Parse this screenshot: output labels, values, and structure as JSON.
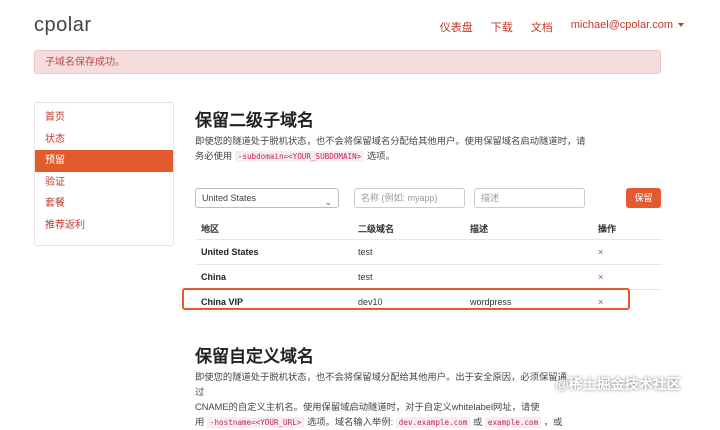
{
  "header": {
    "brand": "cpolar",
    "nav": [
      {
        "label": "仪表盘"
      },
      {
        "label": "下载"
      },
      {
        "label": "文档"
      },
      {
        "label": "michael@cpolar.com"
      }
    ]
  },
  "alert": {
    "text": "子域名保存成功。"
  },
  "sidebar": {
    "items": [
      {
        "label": "首页"
      },
      {
        "label": "状态"
      },
      {
        "label": "预留"
      },
      {
        "label": "验证"
      },
      {
        "label": "套餐"
      },
      {
        "label": "推荐返利"
      }
    ],
    "active_index": 2
  },
  "subdomain": {
    "title": "保留二级子域名",
    "desc_part1": "即使您的隧道处于脱机状态，也不会将保留域名分配给其他用户。使用保留域名启动隧道时，请务必使用",
    "desc_code": "-subdomain=<YOUR_SUBDOMAIN>",
    "desc_part2": "选项。",
    "form": {
      "region_selected": "United States",
      "name_placeholder": "名称 (例如: myapp)",
      "desc_placeholder": "描述",
      "save_label": "保留"
    },
    "table": {
      "headers": [
        "地区",
        "二级域名",
        "描述",
        "操作"
      ],
      "rows": [
        {
          "region": "United States",
          "subdomain": "test",
          "description": "",
          "action": "×"
        },
        {
          "region": "China",
          "subdomain": "test",
          "description": "",
          "action": "×"
        },
        {
          "region": "China VIP",
          "subdomain": "dev10",
          "description": "wordpress",
          "action": "×"
        }
      ]
    }
  },
  "custom": {
    "title": "保留自定义域名",
    "desc_line1": "即使您的隧道处于脱机状态，也不会将保留域分配给其他用户。出于安全原因，必须保留通过",
    "desc_line2": "CNAME的自定义主机名。使用保留域启动隧道时，对于自定义whitelabel网址，请使",
    "desc_line3_pre": "用",
    "desc_code1": "-hostname=<YOUR_URL>",
    "desc_line3_mid": "选项。域名输入举例:",
    "desc_code2": "dev.example.com",
    "desc_or": "或",
    "desc_code3": "example.com",
    "desc_tail": "，或"
  },
  "watermark": "@稀土掘金技术社区",
  "colors": {
    "accent": "#e35a2f",
    "link": "#c0392b",
    "alert_bg": "#f6dddd"
  }
}
